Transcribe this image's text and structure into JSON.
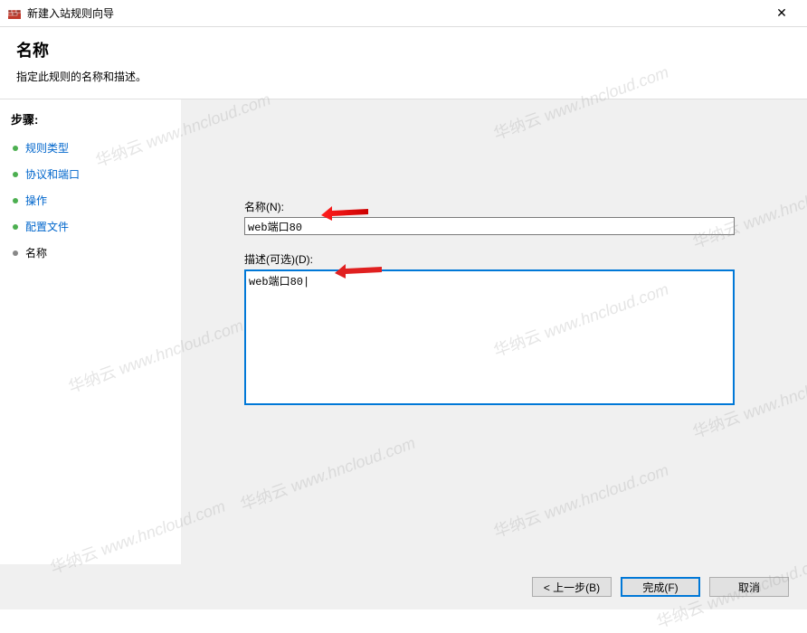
{
  "window": {
    "title": "新建入站规则向导"
  },
  "header": {
    "title": "名称",
    "subtitle": "指定此规则的名称和描述。"
  },
  "sidebar": {
    "heading": "步骤:",
    "items": [
      {
        "label": "规则类型",
        "active": false
      },
      {
        "label": "协议和端口",
        "active": false
      },
      {
        "label": "操作",
        "active": false
      },
      {
        "label": "配置文件",
        "active": false
      },
      {
        "label": "名称",
        "active": true
      }
    ]
  },
  "form": {
    "name_label": "名称(N):",
    "name_value": "web端口80",
    "desc_label": "描述(可选)(D):",
    "desc_value": "web端口80"
  },
  "footer": {
    "back_label": "< 上一步(B)",
    "finish_label": "完成(F)",
    "cancel_label": "取消"
  },
  "watermark": {
    "cn": "华纳云",
    "en": "www.hncloud.com"
  }
}
